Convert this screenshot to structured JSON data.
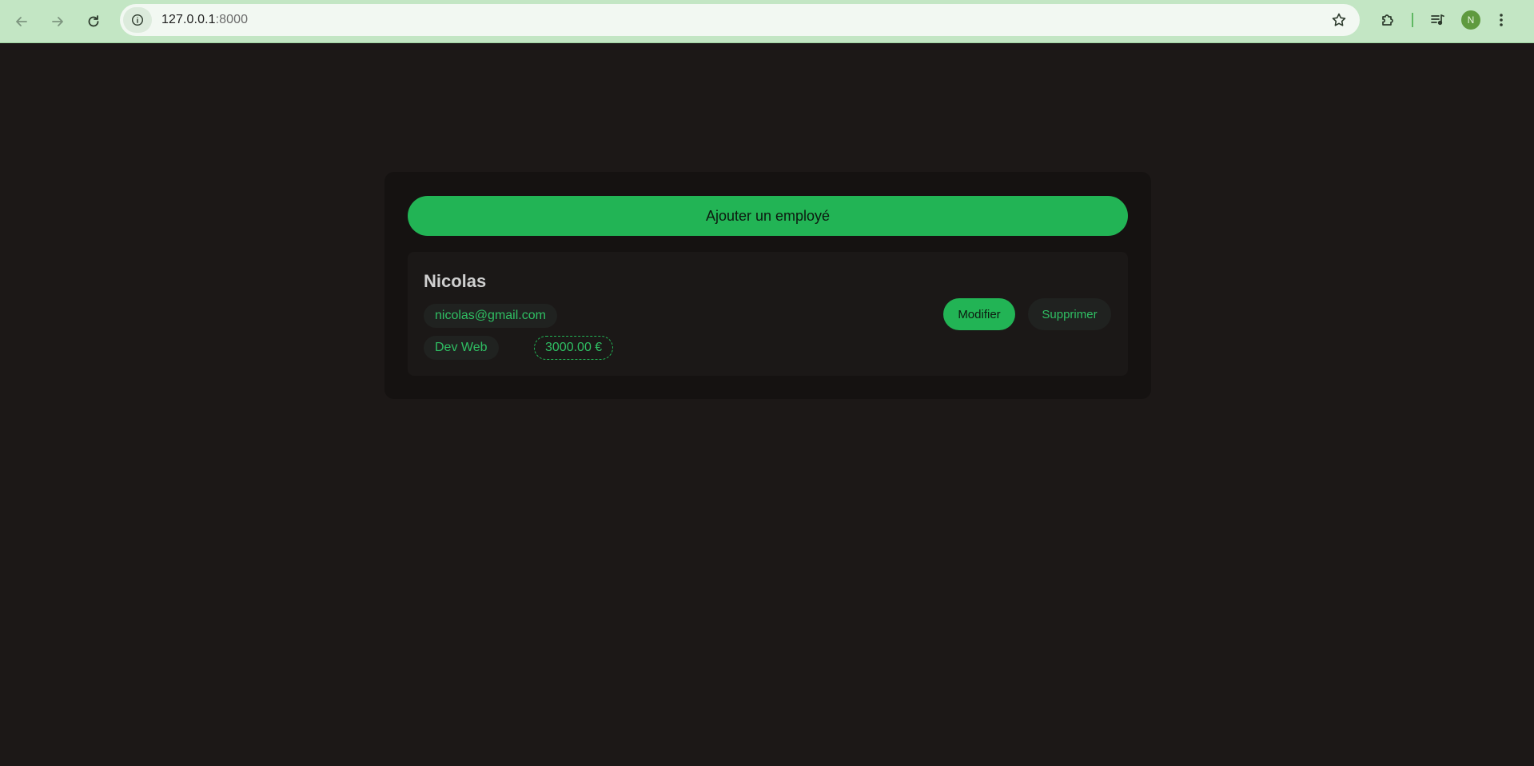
{
  "browser": {
    "url_host": "127.0.0.1",
    "url_port": ":8000",
    "profile_initial": "N",
    "icons": {
      "back": "arrow-left-icon",
      "forward": "arrow-right-icon",
      "reload": "reload-icon",
      "site_info": "info-icon",
      "bookmark": "star-icon",
      "extensions": "puzzle-icon",
      "media": "media-queue-icon",
      "menu": "kebab-menu-icon"
    }
  },
  "page": {
    "add_button_label": "Ajouter un employé",
    "employees": [
      {
        "name": "Nicolas",
        "email": "nicolas@gmail.com",
        "role": "Dev Web",
        "salary": "3000.00 €",
        "edit_label": "Modifier",
        "delete_label": "Supprimer"
      }
    ]
  },
  "colors": {
    "background": "#1c1817",
    "panel": "#151211",
    "card": "#1b1817",
    "accent": "#22b455",
    "chip_bg": "#202220",
    "chrome": "#c3e6c4"
  }
}
